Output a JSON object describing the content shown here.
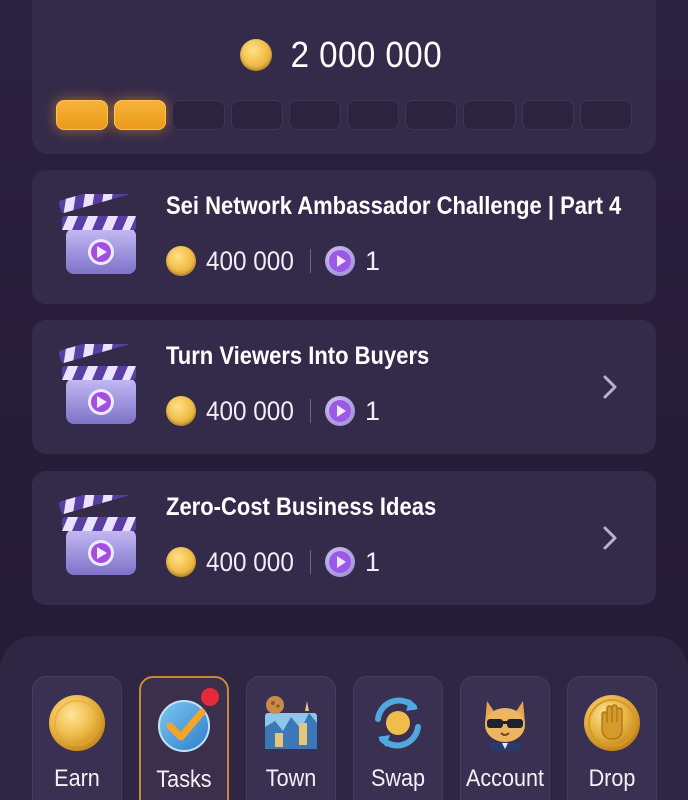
{
  "balance": {
    "value": "2 000 000",
    "progress_filled": 2,
    "progress_total": 10
  },
  "tasks": [
    {
      "title": "Sei Network Ambassador Challenge | Part 4",
      "reward": "400 000",
      "videos": "1",
      "has_chevron": false
    },
    {
      "title": "Turn Viewers Into Buyers",
      "reward": "400 000",
      "videos": "1",
      "has_chevron": true
    },
    {
      "title": "Zero-Cost Business Ideas",
      "reward": "400 000",
      "videos": "1",
      "has_chevron": true
    }
  ],
  "nav": {
    "items": [
      {
        "label": "Earn",
        "icon": "coin-icon",
        "active": false
      },
      {
        "label": "Tasks",
        "icon": "checkmark-icon",
        "active": true,
        "notification": true
      },
      {
        "label": "Town",
        "icon": "town-icon",
        "active": false
      },
      {
        "label": "Swap",
        "icon": "swap-icon",
        "active": false
      },
      {
        "label": "Account",
        "icon": "cat-avatar-icon",
        "active": false
      },
      {
        "label": "Drop",
        "icon": "hand-coin-icon",
        "active": false
      }
    ]
  },
  "colors": {
    "background": "#2a1f3a",
    "card": "#342a4a",
    "accent_gold": "#f3a52a",
    "active_border": "#c88a3a",
    "notification": "#e52a3a"
  }
}
